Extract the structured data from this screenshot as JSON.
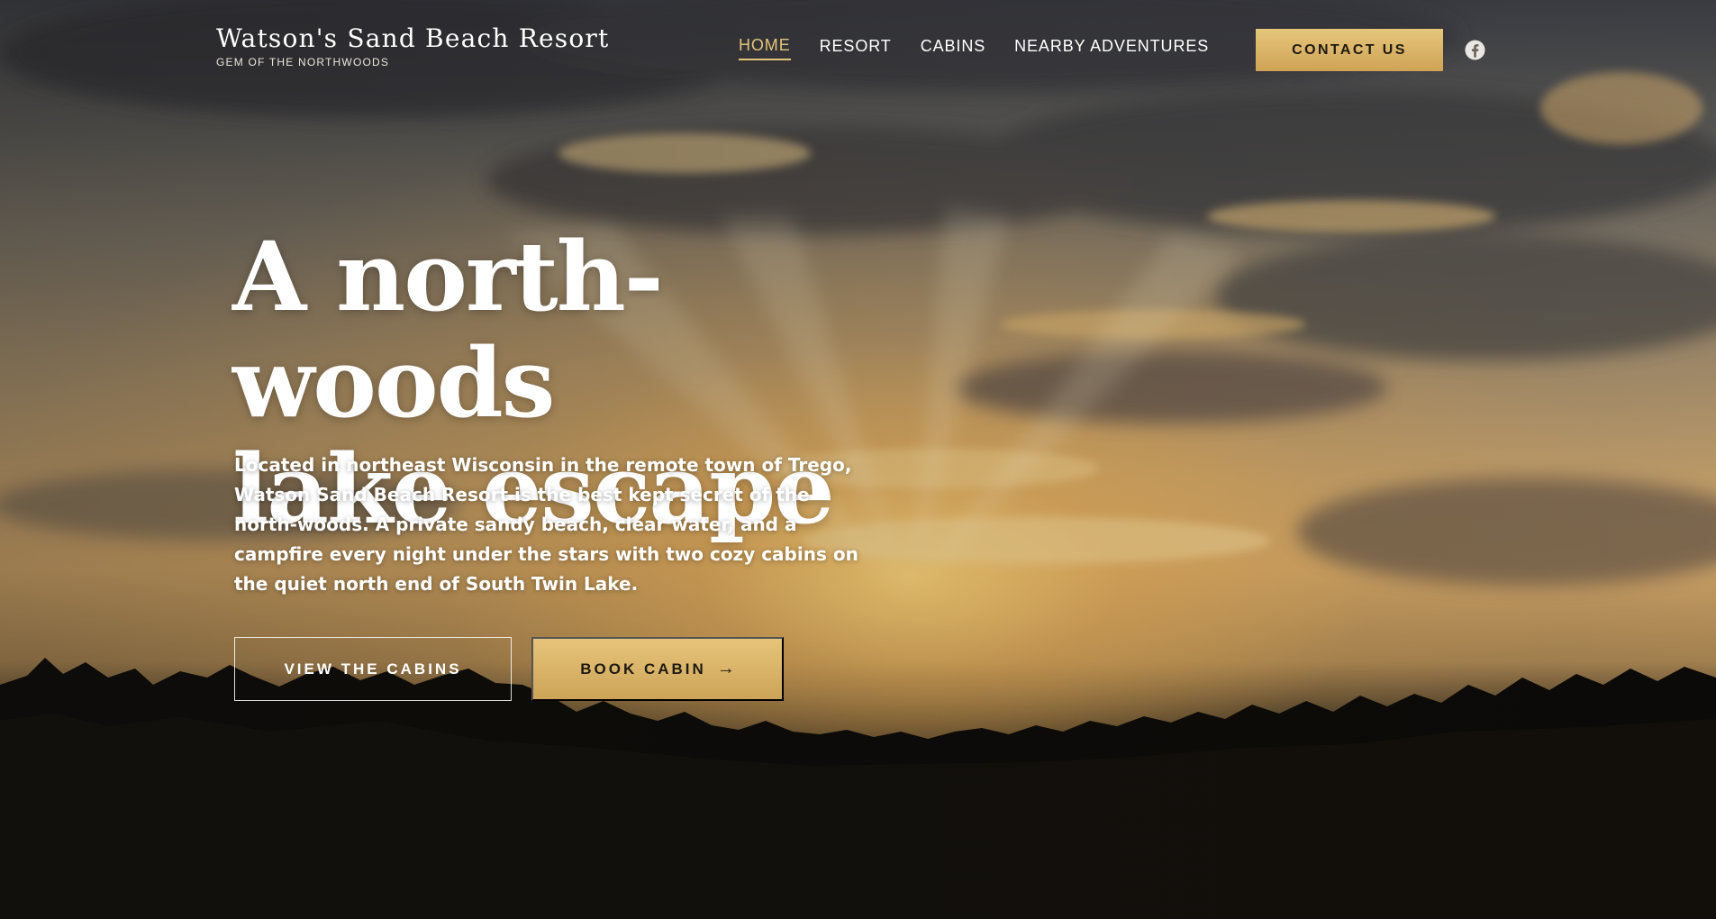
{
  "brand": {
    "title": "Watson's Sand Beach Resort",
    "tagline": "GEM OF THE NORTHWOODS"
  },
  "nav": {
    "items": [
      {
        "label": "HOME",
        "active": true
      },
      {
        "label": "RESORT",
        "active": false
      },
      {
        "label": "CABINS",
        "active": false
      },
      {
        "label": "NEARBY ADVENTURES",
        "active": false
      }
    ],
    "contact_label": "CONTACT US",
    "social_icon": "facebook-icon"
  },
  "hero": {
    "title_line1": "A north-woods",
    "title_line2": "lake escape",
    "description": "Located in northeast Wisconsin in the remote town of Trego, Watson Sand Beach Resort is the best kept secret of the north-woods. A private sandy beach, clear water, and a campfire every night under the stars with two cozy cabins on the quiet north end of South Twin Lake.",
    "view_cabins_label": "VIEW THE CABINS",
    "book_cabin_label": "BOOK CABIN",
    "book_cabin_arrow": "→"
  },
  "colors": {
    "accent_gold": "#d9b468",
    "active_nav": "#e4c47a",
    "text_light": "#ffffff"
  }
}
